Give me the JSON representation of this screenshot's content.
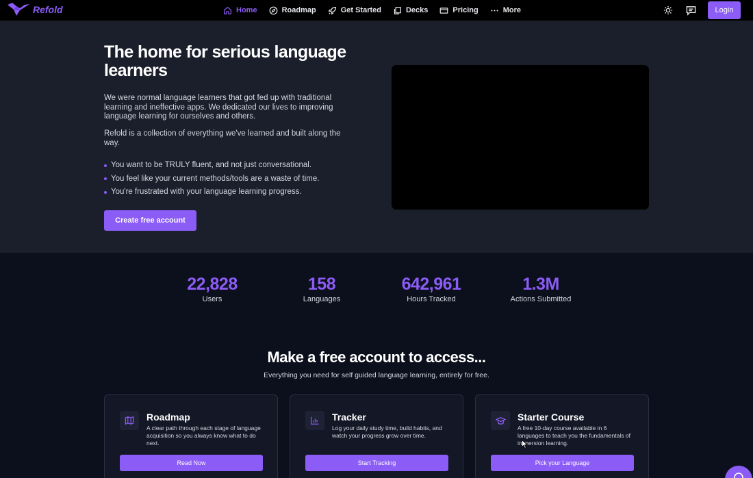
{
  "brand": {
    "name": "Refold",
    "accent": "#8b5cf6"
  },
  "nav": {
    "links": [
      {
        "label": "Home",
        "icon": "home-icon",
        "active": true
      },
      {
        "label": "Roadmap",
        "icon": "compass-icon",
        "active": false
      },
      {
        "label": "Get Started",
        "icon": "rocket-icon",
        "active": false
      },
      {
        "label": "Decks",
        "icon": "cards-icon",
        "active": false
      },
      {
        "label": "Pricing",
        "icon": "credit-card-icon",
        "active": false
      },
      {
        "label": "More",
        "icon": "dots-icon",
        "active": false
      }
    ],
    "login_label": "Login"
  },
  "hero": {
    "title": "The home for serious language learners",
    "p1": "We were normal language learners that got fed up with traditional learning and ineffective apps. We dedicated our lives to improving language learning for ourselves and others.",
    "p2": "Refold is a collection of everything we've learned and built along the way.",
    "bullets": [
      "You want to be TRULY fluent, and not just conversational.",
      "You feel like your current methods/tools are a waste of time.",
      "You're frustrated with your language learning progress."
    ],
    "cta_label": "Create free account"
  },
  "stats": [
    {
      "value": "22,828",
      "label": "Users"
    },
    {
      "value": "158",
      "label": "Languages"
    },
    {
      "value": "642,961",
      "label": "Hours Tracked"
    },
    {
      "value": "1.3M",
      "label": "Actions Submitted"
    }
  ],
  "features": {
    "title": "Make a free account to access...",
    "subtitle": "Everything you need for self guided language learning, entirely for free.",
    "cards": [
      {
        "title": "Roadmap",
        "icon": "map-icon",
        "desc": "A clear path through each stage of language acquisition so you always know what to do next.",
        "button": "Read Now"
      },
      {
        "title": "Tracker",
        "icon": "bar-chart-icon",
        "desc": "Log your daily study time, build habits, and watch your progress grow over time.",
        "button": "Start Tracking"
      },
      {
        "title": "Starter Course",
        "icon": "graduation-cap-icon",
        "desc": "A free 10-day course available in 6 languages to teach you the fundamentals of immersion learning.",
        "button": "Pick your Language"
      }
    ]
  }
}
